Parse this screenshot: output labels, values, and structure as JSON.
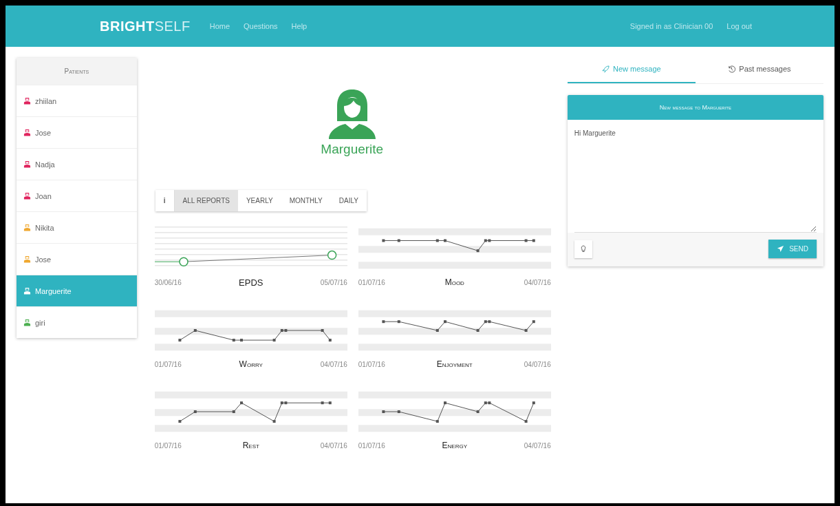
{
  "header": {
    "logo_bold": "BRIGHT",
    "logo_light": "SELF",
    "nav": [
      "Home",
      "Questions",
      "Help"
    ],
    "signed_in": "Signed in as Clinician 00",
    "logout": "Log out"
  },
  "sidebar": {
    "title": "Patients",
    "patients": [
      {
        "name": "zhiilan",
        "color": "#e0245e",
        "selected": false
      },
      {
        "name": "Jose",
        "color": "#e0245e",
        "selected": false
      },
      {
        "name": "Nadja",
        "color": "#e0245e",
        "selected": false
      },
      {
        "name": "Joan",
        "color": "#e0245e",
        "selected": false
      },
      {
        "name": "Nikita",
        "color": "#f0a830",
        "selected": false
      },
      {
        "name": "Jose",
        "color": "#f0a830",
        "selected": false
      },
      {
        "name": "Marguerite",
        "color": "#ffffff",
        "selected": true
      },
      {
        "name": "giri",
        "color": "#4caf50",
        "selected": false
      }
    ]
  },
  "profile": {
    "name": "Marguerite"
  },
  "report_tabs": {
    "info": "i",
    "tabs": [
      {
        "label": "ALL REPORTS",
        "selected": true
      },
      {
        "label": "YEARLY",
        "selected": false
      },
      {
        "label": "MONTHLY",
        "selected": false
      },
      {
        "label": "DAILY",
        "selected": false
      }
    ]
  },
  "charts": [
    {
      "kind": "epds",
      "title": "EPDS",
      "start": "30/06/16",
      "end": "05/07/16"
    },
    {
      "kind": "line",
      "title": "Mood",
      "start": "01/07/16",
      "end": "04/07/16"
    },
    {
      "kind": "line",
      "title": "Worry",
      "start": "01/07/16",
      "end": "04/07/16"
    },
    {
      "kind": "line",
      "title": "Enjoyment",
      "start": "01/07/16",
      "end": "04/07/16"
    },
    {
      "kind": "line",
      "title": "Rest",
      "start": "01/07/16",
      "end": "04/07/16"
    },
    {
      "kind": "line",
      "title": "Energy",
      "start": "01/07/16",
      "end": "04/07/16"
    }
  ],
  "messages": {
    "tabs": [
      {
        "label": "New message",
        "selected": true
      },
      {
        "label": "Past messages",
        "selected": false
      }
    ],
    "header": "New message to Marguerite",
    "body": "Hi Marguerite",
    "send": "SEND"
  }
}
